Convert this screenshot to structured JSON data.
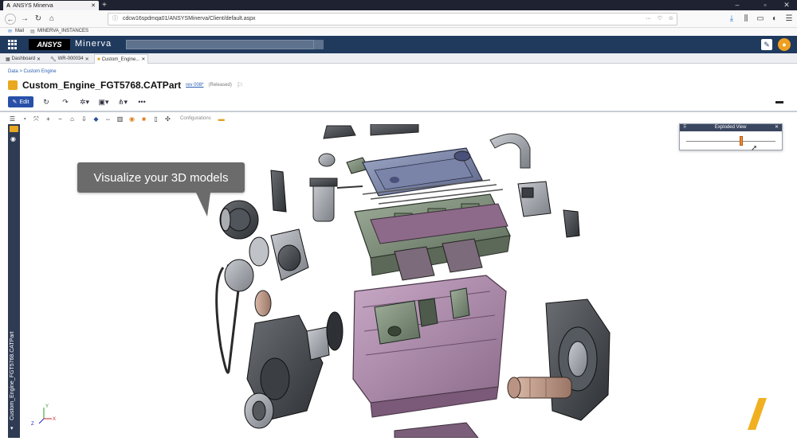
{
  "browser": {
    "tab_title": "ANSYS Minerva",
    "url": "cdcw16spdmqa01/ANSYSMinerva/Client/default.aspx",
    "bookmarks": [
      "Mail",
      "MINERVA_INSTANCES"
    ]
  },
  "app": {
    "logo": "ANSYS",
    "name": "Minerva",
    "tabs": [
      {
        "label": "Dashboard"
      },
      {
        "label": "WR-000034"
      },
      {
        "label": "Custom_Engine..."
      }
    ]
  },
  "page": {
    "breadcrumb": "Data  >  Custom Engine",
    "title": "Custom_Engine_FGT5768.CATPart",
    "revision": "rev 008*",
    "status": "(Released)",
    "edit_label": "Edit",
    "side_label": "Custom_Engine_FGT5768.CATPart"
  },
  "viewer": {
    "configurations_label": "Configurations",
    "callout_text": "Visualize your 3D models",
    "exploded_title": "Exploded View",
    "exploded_level": 0.62
  },
  "colors": {
    "app_header": "#203a5e",
    "edit_button": "#2850a8",
    "slider_thumb": "#f08a2e"
  }
}
